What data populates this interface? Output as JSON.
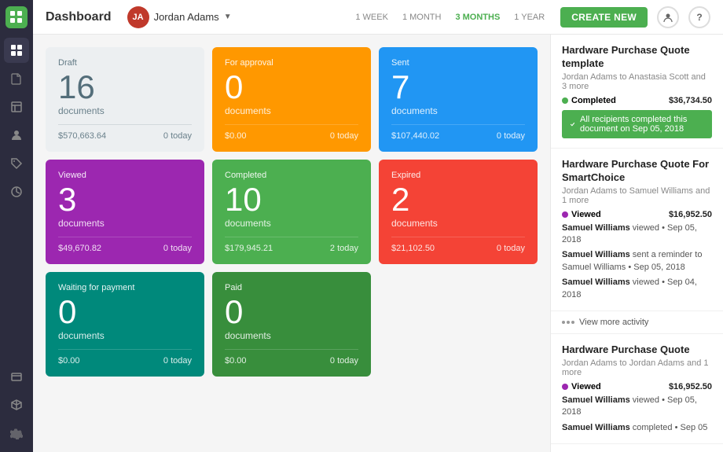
{
  "header": {
    "title": "Dashboard",
    "user": {
      "name": "Jordan Adams",
      "initials": "JA"
    },
    "time_filters": [
      "1 WEEK",
      "1 MONTH",
      "3 MONTHS",
      "1 YEAR"
    ],
    "active_filter": "3 MONTHS",
    "create_btn": "CREATE NEW"
  },
  "cards": [
    {
      "id": "draft",
      "label": "Draft",
      "count": "16",
      "docs": "documents",
      "amount": "$570,663.64",
      "today": "0 today",
      "color": "draft"
    },
    {
      "id": "approval",
      "label": "For approval",
      "count": "0",
      "docs": "documents",
      "amount": "$0.00",
      "today": "0 today",
      "color": "approval"
    },
    {
      "id": "sent",
      "label": "Sent",
      "count": "7",
      "docs": "documents",
      "amount": "$107,440.02",
      "today": "0 today",
      "color": "sent"
    },
    {
      "id": "viewed",
      "label": "Viewed",
      "count": "3",
      "docs": "documents",
      "amount": "$49,670.82",
      "today": "0 today",
      "color": "viewed"
    },
    {
      "id": "completed",
      "label": "Completed",
      "count": "10",
      "docs": "documents",
      "amount": "$179,945.21",
      "today": "2 today",
      "color": "completed"
    },
    {
      "id": "expired",
      "label": "Expired",
      "count": "2",
      "docs": "documents",
      "amount": "$21,102.50",
      "today": "0 today",
      "color": "expired"
    },
    {
      "id": "waiting",
      "label": "Waiting for payment",
      "count": "0",
      "docs": "documents",
      "amount": "$0.00",
      "today": "0 today",
      "color": "waiting"
    },
    {
      "id": "paid",
      "label": "Paid",
      "count": "0",
      "docs": "documents",
      "amount": "$0.00",
      "today": "0 today",
      "color": "paid"
    }
  ],
  "sidebar": {
    "items": [
      {
        "id": "grid",
        "icon": "⊞",
        "active": true
      },
      {
        "id": "docs",
        "icon": "📄",
        "active": false
      },
      {
        "id": "templates",
        "icon": "⊡",
        "active": false
      },
      {
        "id": "contacts",
        "icon": "👤",
        "active": false
      },
      {
        "id": "tags",
        "icon": "🏷",
        "active": false
      },
      {
        "id": "reports",
        "icon": "📊",
        "active": false
      },
      {
        "id": "settings-bottom",
        "icon": "⚙",
        "active": false
      }
    ]
  },
  "activity": [
    {
      "id": "hw-quote-template",
      "title": "Hardware Purchase Quote template",
      "subtitle": "Jordan Adams to Anastasia Scott and 3 more",
      "status": "Completed",
      "status_type": "completed",
      "amount": "$36,734.50",
      "banner": "All recipients completed this document on Sep 05, 2018",
      "logs": []
    },
    {
      "id": "hw-quote-smartchoice",
      "title": "Hardware Purchase Quote For SmartChoice",
      "subtitle": "Jordan Adams to Samuel Williams and 1 more",
      "status": "Viewed",
      "status_type": "viewed",
      "amount": "$16,952.50",
      "banner": null,
      "logs": [
        {
          "bold": "Samuel Williams",
          "text": " viewed • Sep 05, 2018"
        },
        {
          "bold": "Samuel Williams",
          "text": " sent a reminder to Samuel Williams • Sep 05, 2018"
        },
        {
          "bold": "Samuel Williams",
          "text": " viewed • Sep 04, 2018"
        }
      ]
    },
    {
      "id": "view-more",
      "label": "View more activity"
    },
    {
      "id": "hw-quote-jordan",
      "title": "Hardware Purchase Quote",
      "subtitle": "Jordan Adams to Jordan Adams and 1 more",
      "status": "Viewed",
      "status_type": "viewed",
      "amount": "$16,952.50",
      "banner": null,
      "logs": [
        {
          "bold": "Samuel Williams",
          "text": " viewed • Sep 05, 2018"
        },
        {
          "bold": "Samuel Williams",
          "text": " completed • Sep 05"
        }
      ]
    }
  ]
}
